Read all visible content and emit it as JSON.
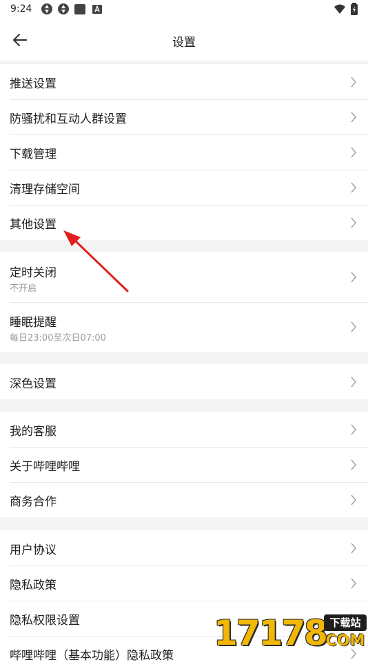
{
  "status_bar": {
    "time": "9:24"
  },
  "header": {
    "title": "设置"
  },
  "groups": [
    {
      "items": [
        {
          "label": "推送设置"
        },
        {
          "label": "防骚扰和互动人群设置"
        },
        {
          "label": "下载管理"
        },
        {
          "label": "清理存储空间"
        },
        {
          "label": "其他设置"
        }
      ]
    },
    {
      "items": [
        {
          "label": "定时关闭",
          "sub": "不开启"
        },
        {
          "label": "睡眠提醒",
          "sub": "每日23:00至次日07:00"
        }
      ]
    },
    {
      "items": [
        {
          "label": "深色设置"
        }
      ]
    },
    {
      "items": [
        {
          "label": "我的客服"
        },
        {
          "label": "关于哔哩哔哩"
        },
        {
          "label": "商务合作"
        }
      ]
    },
    {
      "items": [
        {
          "label": "用户协议"
        },
        {
          "label": "隐私政策"
        },
        {
          "label": "隐私权限设置"
        },
        {
          "label": "哔哩哔哩（基本功能）隐私政策"
        }
      ]
    }
  ],
  "watermark": {
    "digits": "17178",
    "badge": "下载站",
    "domain": "COM"
  },
  "colors": {
    "annotation_arrow": "#e0201b",
    "watermark": "#f2b705"
  }
}
